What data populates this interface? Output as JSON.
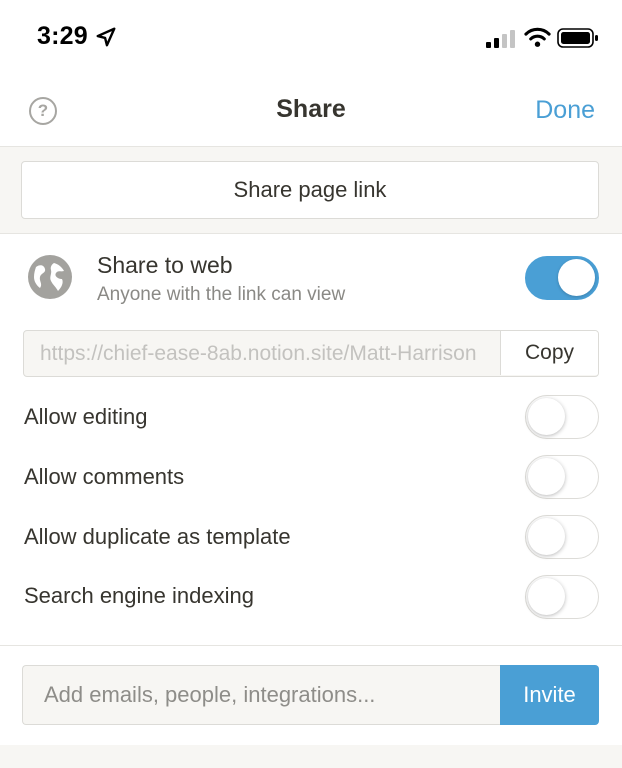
{
  "status_bar": {
    "time": "3:29",
    "icons": [
      "location-arrow-icon",
      "cellular-signal-icon",
      "wifi-icon",
      "battery-icon"
    ]
  },
  "header": {
    "title": "Share",
    "done_label": "Done",
    "help_glyph": "?"
  },
  "share_link": {
    "label": "Share page link"
  },
  "share_to_web": {
    "title": "Share to web",
    "subtitle": "Anyone with the link can view",
    "enabled": true,
    "url": "https://chief-ease-8ab.notion.site/Matt-Harrison",
    "copy_label": "Copy"
  },
  "options": [
    {
      "label": "Allow editing",
      "enabled": false
    },
    {
      "label": "Allow comments",
      "enabled": false
    },
    {
      "label": "Allow duplicate as template",
      "enabled": false
    },
    {
      "label": "Search engine indexing",
      "enabled": false
    }
  ],
  "invite": {
    "placeholder": "Add emails, people, integrations...",
    "button_label": "Invite"
  },
  "colors": {
    "accent": "#4a9fd5",
    "text": "#37352f",
    "muted": "#8a8985",
    "band": "#f7f6f3"
  }
}
